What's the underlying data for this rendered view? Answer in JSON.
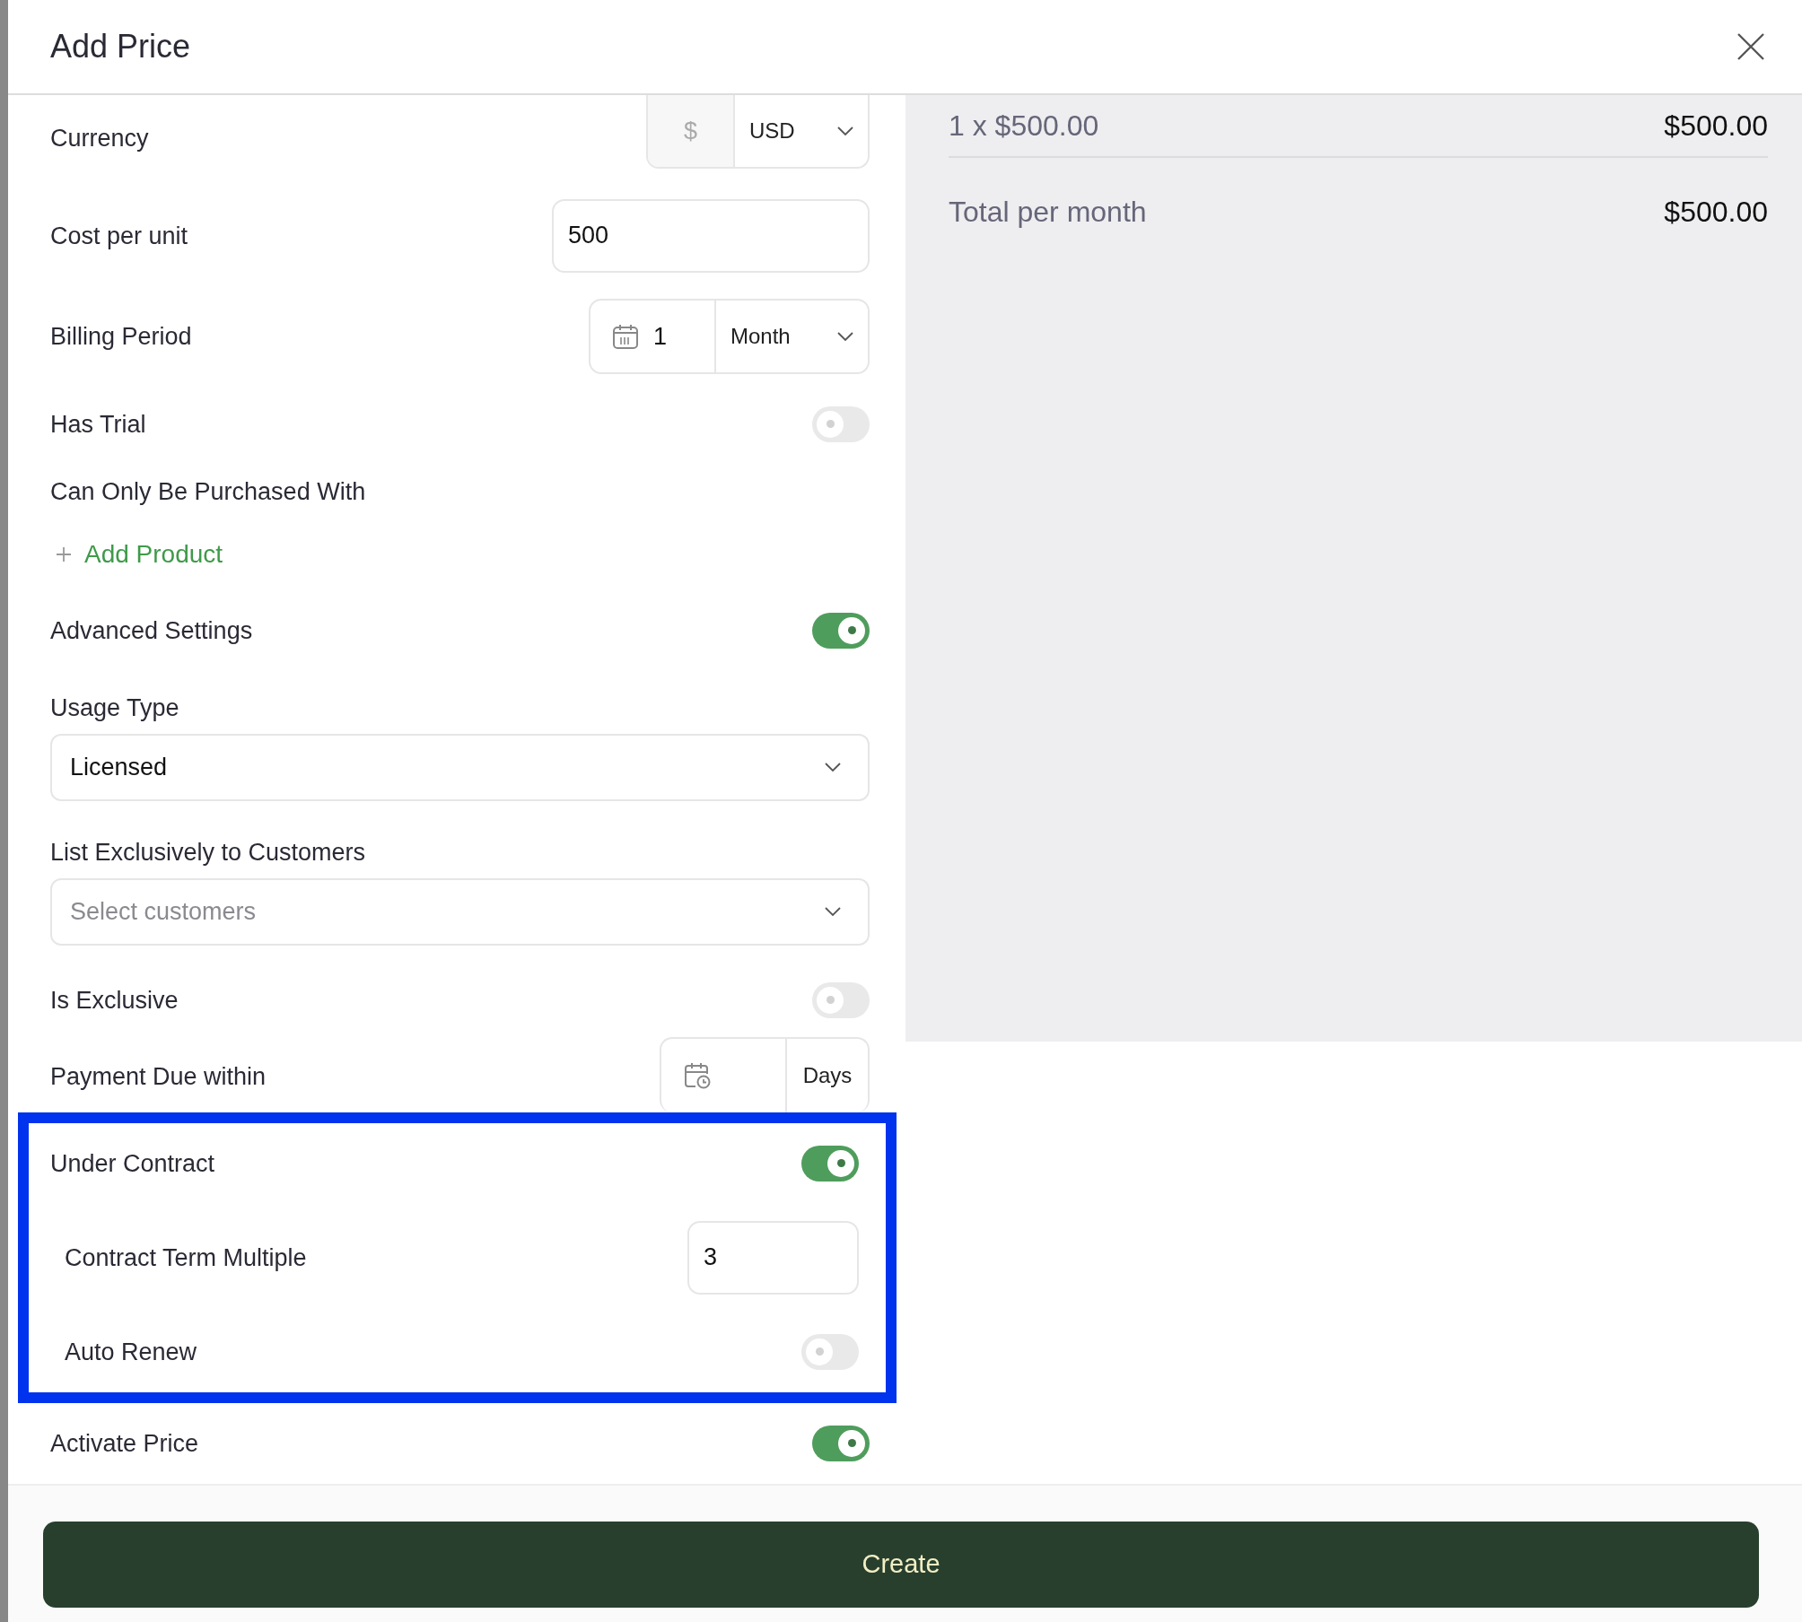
{
  "dialog": {
    "title": "Add Price"
  },
  "fields": [
    {
      "kind": "currency",
      "label": "Currency",
      "prefix": "$",
      "value": "USD"
    },
    {
      "kind": "input",
      "label": "Cost per unit",
      "value": "500"
    },
    {
      "kind": "period",
      "label": "Billing Period",
      "value": "1",
      "unit": "Month"
    },
    {
      "kind": "toggle",
      "label": "Has Trial",
      "on": false
    },
    {
      "kind": "heading",
      "label": "Can Only Be Purchased With"
    },
    {
      "kind": "link",
      "label": "Add Product"
    },
    {
      "kind": "toggle",
      "label": "Advanced Settings",
      "on": true
    },
    {
      "kind": "select",
      "label": "Usage Type",
      "value": "Licensed"
    },
    {
      "kind": "select",
      "label": "List Exclusively to Customers",
      "placeholder": "Select customers"
    },
    {
      "kind": "toggle",
      "label": "Is Exclusive",
      "on": false
    },
    {
      "kind": "days",
      "label": "Payment Due within",
      "unit": "Days"
    }
  ],
  "contract_section": {
    "highlighted": true,
    "items": [
      {
        "kind": "toggle",
        "label": "Under Contract",
        "on": true
      },
      {
        "kind": "input",
        "label": "Contract Term Multiple",
        "value": "3"
      },
      {
        "kind": "toggle",
        "label": "Auto Renew",
        "on": false
      }
    ]
  },
  "after_fields": [
    {
      "kind": "toggle",
      "label": "Activate Price",
      "on": true
    }
  ],
  "summary": {
    "line_item": {
      "label": "1 x $500.00",
      "amount": "$500.00"
    },
    "total": {
      "label": "Total per month",
      "amount": "$500.00"
    }
  },
  "footer": {
    "button": "Create"
  }
}
